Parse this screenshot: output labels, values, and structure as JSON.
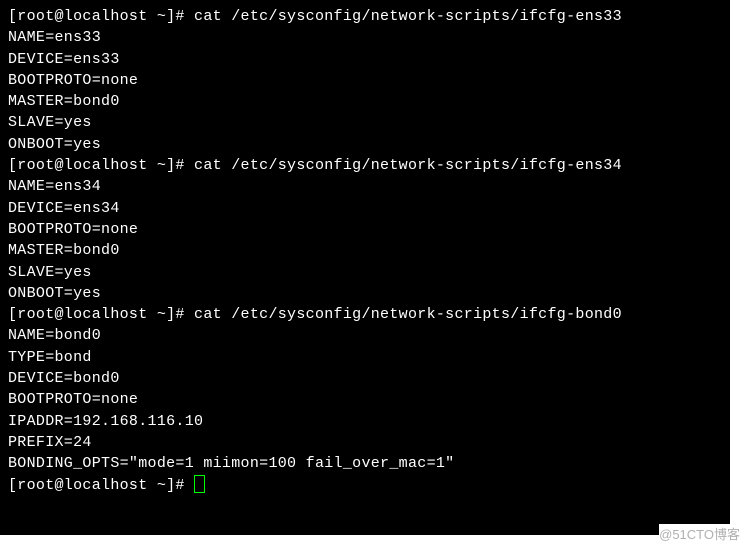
{
  "prompt": "[root@localhost ~]# ",
  "blocks": [
    {
      "cmd": "cat /etc/sysconfig/network-scripts/ifcfg-ens33",
      "output": [
        "NAME=ens33",
        "DEVICE=ens33",
        "BOOTPROTO=none",
        "MASTER=bond0",
        "SLAVE=yes",
        "ONBOOT=yes"
      ]
    },
    {
      "cmd": "cat /etc/sysconfig/network-scripts/ifcfg-ens34",
      "output": [
        "NAME=ens34",
        "DEVICE=ens34",
        "BOOTPROTO=none",
        "MASTER=bond0",
        "SLAVE=yes",
        "ONBOOT=yes"
      ]
    },
    {
      "cmd": "cat /etc/sysconfig/network-scripts/ifcfg-bond0",
      "output": [
        "NAME=bond0",
        "TYPE=bond",
        "DEVICE=bond0",
        "BOOTPROTO=none",
        "IPADDR=192.168.116.10",
        "PREFIX=24",
        "BONDING_OPTS=\"mode=1 miimon=100 fail_over_mac=1\""
      ]
    }
  ],
  "watermark": "@51CTO博客"
}
